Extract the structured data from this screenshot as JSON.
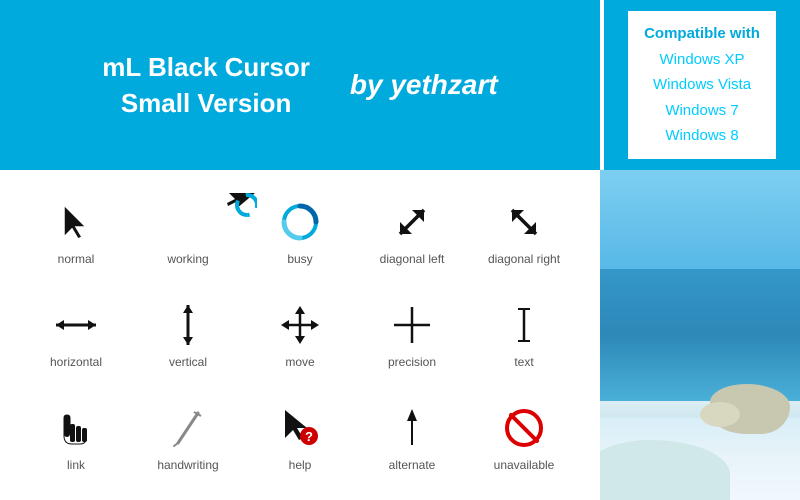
{
  "header": {
    "title_line1": "mL Black Cursor",
    "title_line2": "Small Version",
    "author": "by yethzart",
    "compat_title": "Compatible with",
    "compat_os": [
      "Windows XP",
      "Windows Vista",
      "Windows 7",
      "Windows 8"
    ]
  },
  "cursors": {
    "rows": [
      [
        {
          "id": "normal",
          "label": "normal",
          "icon_type": "normal"
        },
        {
          "id": "working",
          "label": "working",
          "icon_type": "working"
        },
        {
          "id": "busy",
          "label": "busy",
          "icon_type": "busy"
        },
        {
          "id": "diagonal-left",
          "label": "diagonal left",
          "icon_type": "diag-left"
        },
        {
          "id": "diagonal-right",
          "label": "diagonal right",
          "icon_type": "diag-right"
        }
      ],
      [
        {
          "id": "horizontal",
          "label": "horizontal",
          "icon_type": "horiz"
        },
        {
          "id": "vertical",
          "label": "vertical",
          "icon_type": "vert"
        },
        {
          "id": "move",
          "label": "move",
          "icon_type": "move"
        },
        {
          "id": "precision",
          "label": "precision",
          "icon_type": "precision"
        },
        {
          "id": "text",
          "label": "text",
          "icon_type": "text"
        }
      ],
      [
        {
          "id": "link",
          "label": "link",
          "icon_type": "link"
        },
        {
          "id": "handwriting",
          "label": "handwriting",
          "icon_type": "handwriting"
        },
        {
          "id": "help",
          "label": "help",
          "icon_type": "help"
        },
        {
          "id": "alternate",
          "label": "alternate",
          "icon_type": "alternate"
        },
        {
          "id": "unavailable",
          "label": "unavailable",
          "icon_type": "unavailable"
        }
      ]
    ]
  }
}
